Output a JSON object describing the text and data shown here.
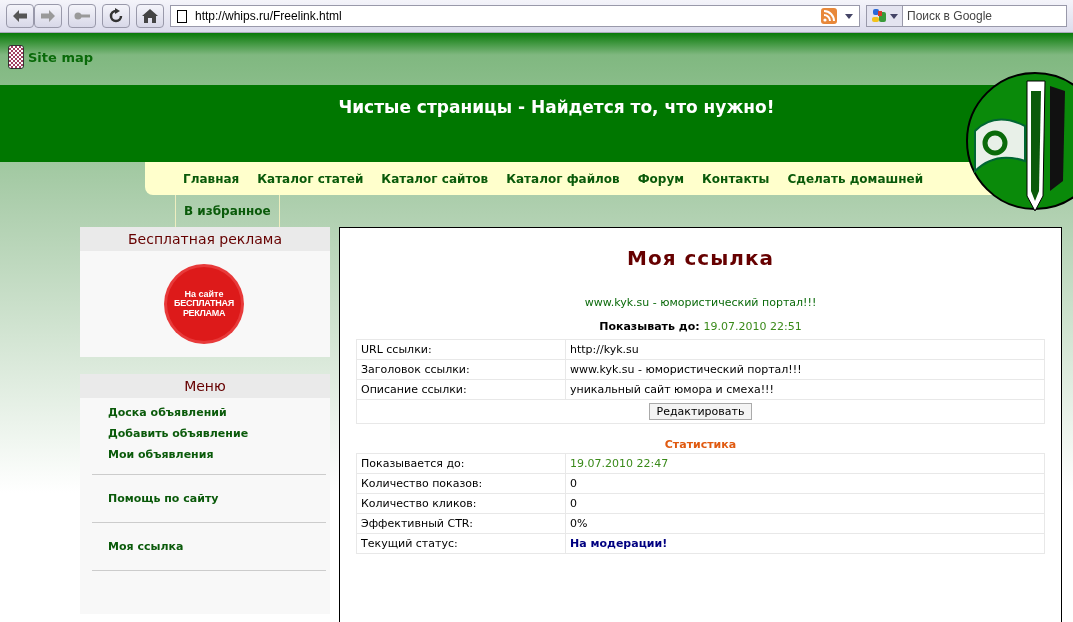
{
  "browser": {
    "address": "http://whips.ru/Freelink.html",
    "search_placeholder": "Поиск в Google"
  },
  "site_map": "Site map",
  "header": {
    "title": "Чистые страницы - Найдется то, что нужно!"
  },
  "nav": [
    "Главная",
    "Каталог статей",
    "Каталог сайтов",
    "Каталог файлов",
    "Форум",
    "Контакты",
    "Сделать домашней"
  ],
  "nav_extra": "В избранное",
  "ad_block": {
    "title": "Бесплатная реклама",
    "badge": [
      "На сайте",
      "БЕСПЛАТНАЯ",
      "РЕКЛАМА"
    ]
  },
  "menu": {
    "title": "Меню",
    "groups": [
      [
        "Доска объявлений",
        "Добавить объявление",
        "Мои объявления"
      ],
      [
        "Помощь по сайту"
      ],
      [
        "Моя ссылка"
      ]
    ]
  },
  "main": {
    "title": "Моя ссылка",
    "link_title": "www.kyk.su - юмористический портал!!!",
    "show_until_label": "Показывать до:",
    "show_until_value": "19.07.2010 22:51",
    "details": [
      {
        "label": "URL ссылки:",
        "value": "http://kyk.su"
      },
      {
        "label": "Заголовок ссылки:",
        "value": "www.kyk.su - юмористический портал!!!"
      },
      {
        "label": "Описание ссылки:",
        "value": "уникальный сайт юмора и смеха!!!"
      }
    ],
    "edit_button": "Редактировать",
    "stats_title": "Статистика",
    "stats": [
      {
        "label": "Показывается до:",
        "value": "19.07.2010 22:47",
        "kind": "date"
      },
      {
        "label": "Количество показов:",
        "value": "0",
        "kind": "plain"
      },
      {
        "label": "Количество кликов:",
        "value": "0",
        "kind": "plain"
      },
      {
        "label": "Эффективный CTR:",
        "value": "0%",
        "kind": "plain"
      },
      {
        "label": "Текущий статус:",
        "value": "На модерации!",
        "kind": "status"
      }
    ]
  }
}
